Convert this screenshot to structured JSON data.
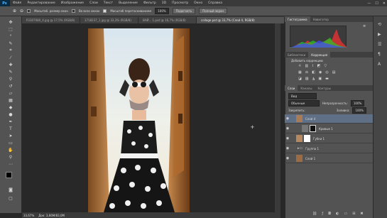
{
  "app": {
    "logo": "Ps"
  },
  "menu": [
    "Файл",
    "Редактирование",
    "Изображение",
    "Слои",
    "Текст",
    "Выделение",
    "Фильтр",
    "3D",
    "Просмотр",
    "Окно",
    "Справка"
  ],
  "window_controls": {
    "min": "—",
    "max": "☐",
    "close": "✕"
  },
  "options": {
    "zoom_all_label": "Масштаб. размер окон",
    "all_windows_label": "Во всех окнах",
    "scrubby_label": "Масштаб перетаскиванием",
    "zoom_value": "100%",
    "fit_button": "Подогнать",
    "fill_button": "Полный экран"
  },
  "tabs": [
    {
      "label": "P3307080_4.jpg @ 17,5% (RGB/8)",
      "active": false
    },
    {
      "label": "1718237_1.jpg @ 33,3% (RGB/8)",
      "active": false
    },
    {
      "label": "ВАЙ... 1.psd @ 16,7% (RGB/8)",
      "active": false
    },
    {
      "label": "collage.psd @ 33,7% (Слой 4, RGB/8)",
      "active": true
    }
  ],
  "status": {
    "zoom": "33,67%",
    "doc": "Док: 3,66M/83,0M"
  },
  "histogram": {
    "tabs": [
      "Гистограмма",
      "Навигатор"
    ]
  },
  "adjustments": {
    "tabs": [
      "Библиотеки",
      "Коррекция"
    ],
    "title": "Добавить коррекцию"
  },
  "layers_panel": {
    "tabs": [
      "Слои",
      "Каналы",
      "Контуры"
    ],
    "kind_label": "Вид",
    "blend_mode": "Обычные",
    "opacity_label": "Непрозрачность:",
    "opacity_value": "100%",
    "lock_label": "Закрепить:",
    "fill_label": "Заливка:",
    "fill_value": "100%",
    "layers": [
      {
        "name": "Слой 4",
        "selected": true,
        "has_mask": false
      },
      {
        "name": "Кривые 1",
        "selected": false,
        "has_mask": true
      },
      {
        "name": "Губки 1",
        "selected": false,
        "has_mask": true
      },
      {
        "name": "Группа 1",
        "selected": false,
        "has_mask": false
      },
      {
        "name": "Слой 1",
        "selected": false,
        "has_mask": false
      }
    ]
  }
}
